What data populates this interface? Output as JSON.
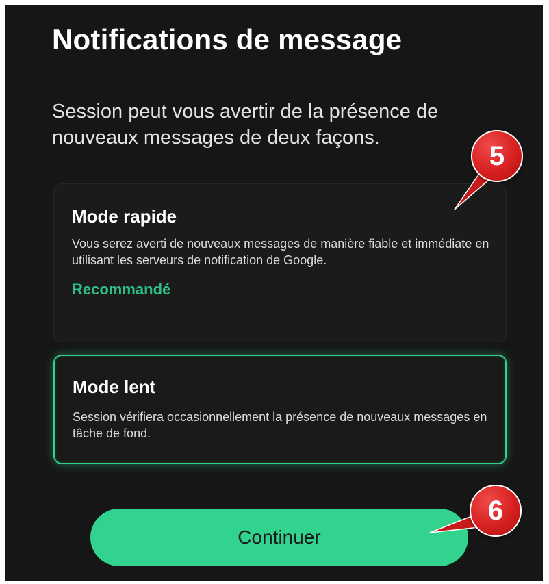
{
  "header": {
    "title": "Notifications de message"
  },
  "intro": "Session peut vous avertir de la présence de nouveaux messages de deux façons.",
  "options": [
    {
      "title": "Mode rapide",
      "description": "Vous serez averti de nouveaux messages de manière fiable et immédiate en utilisant les serveurs de notification de Google.",
      "badge": "Recommandé",
      "selected": false
    },
    {
      "title": "Mode lent",
      "description": "Session vérifiera occasionnellement la présence de nouveaux messages en tâche de fond.",
      "selected": true
    }
  ],
  "actions": {
    "continue_label": "Continuer"
  },
  "annotations": {
    "callout_1": "5",
    "callout_2": "6"
  },
  "colors": {
    "background": "#161616",
    "accent": "#31d38e",
    "badge_text": "#2fbf85",
    "callout": "#d62020"
  }
}
